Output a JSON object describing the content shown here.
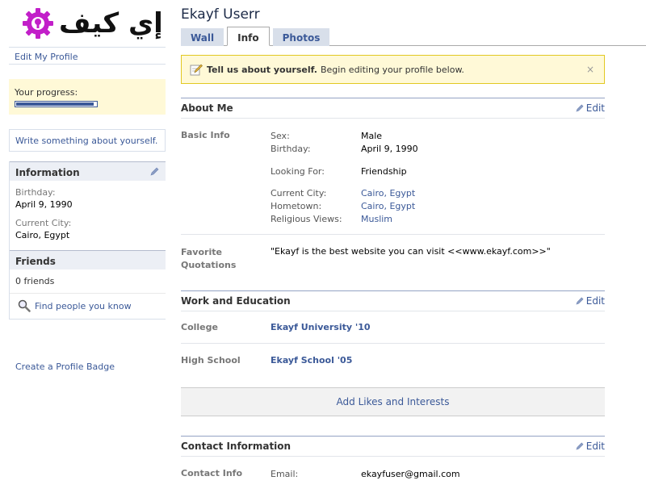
{
  "logo": {
    "wordmark": "إي كيف"
  },
  "sidebar": {
    "edit_profile": "Edit My Profile",
    "progress_label": "Your progress:",
    "progress_fraction": 0.97,
    "write_something": "Write something about yourself.",
    "information_title": "Information",
    "birthday_label": "Birthday:",
    "birthday_value": "April 9, 1990",
    "city_label": "Current City:",
    "city_value": "Cairo, Egypt",
    "friends_title": "Friends",
    "friends_count": "0 friends",
    "find_people": "Find people you know",
    "profile_badge": "Create a Profile Badge"
  },
  "profile": {
    "name": "Ekayf Userr",
    "tabs": [
      {
        "label": "Wall"
      },
      {
        "label": "Info"
      },
      {
        "label": "Photos"
      }
    ]
  },
  "notice": {
    "bold": "Tell us about yourself.",
    "text": "Begin editing your profile below.",
    "close": "×"
  },
  "about": {
    "title": "About Me",
    "edit": "Edit",
    "basic_info_label": "Basic Info",
    "fields": {
      "sex_k": "Sex:",
      "sex_v": "Male",
      "birthday_k": "Birthday:",
      "birthday_v": "April 9, 1990",
      "looking_k": "Looking For:",
      "looking_v": "Friendship",
      "city_k": "Current City:",
      "city_v": "Cairo, Egypt",
      "hometown_k": "Hometown:",
      "hometown_v": "Cairo, Egypt",
      "religion_k": "Religious Views:",
      "religion_v": "Muslim"
    },
    "quotes_label_1": "Favorite",
    "quotes_label_2": "Quotations",
    "quote": "\"Ekayf is the best website you can visit <<www.ekayf.com>>\""
  },
  "work": {
    "title": "Work and Education",
    "edit": "Edit",
    "college_label": "College",
    "college_value": "Ekayf University '10",
    "highschool_label": "High School",
    "highschool_value": "Ekayf School '05"
  },
  "likes": {
    "label": "Add Likes and Interests"
  },
  "contact": {
    "title": "Contact Information",
    "edit": "Edit",
    "label": "Contact Info",
    "email_k": "Email:",
    "email_v": "ekayfuser@gmail.com"
  },
  "colors": {
    "brand": "#3b5998",
    "notice_bg": "#fff9d7",
    "logo_accent": "#c21fc9"
  }
}
